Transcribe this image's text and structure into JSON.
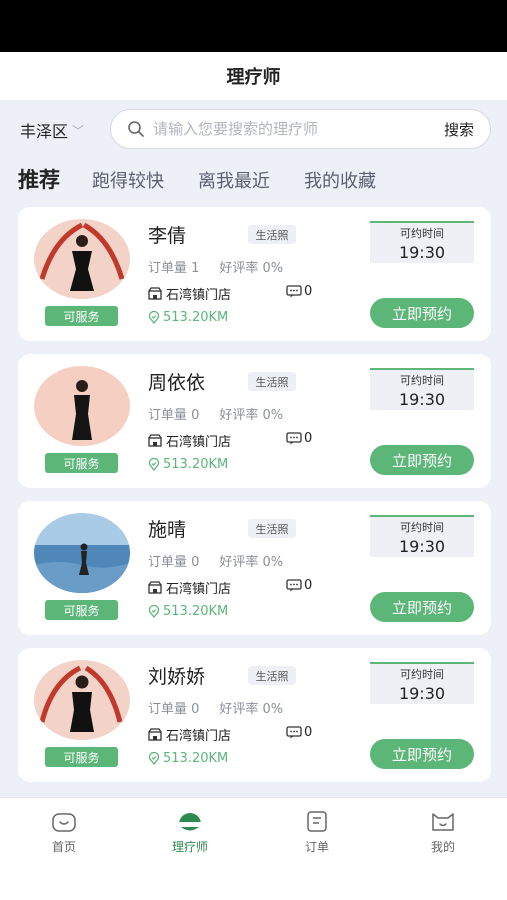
{
  "header": {
    "title": "理疗师"
  },
  "search": {
    "region": "丰泽区",
    "placeholder": "请输入您要搜索的理疗师",
    "button": "搜索"
  },
  "tabs": [
    {
      "label": "推荐",
      "active": true
    },
    {
      "label": "跑得较快",
      "active": false
    },
    {
      "label": "离我最近",
      "active": false
    },
    {
      "label": "我的收藏",
      "active": false
    }
  ],
  "therapists": [
    {
      "name": "李倩",
      "tag": "生活照",
      "orders": "订单量 1",
      "rating": "好评率 0%",
      "store": "石湾镇门店",
      "messages": "0",
      "distance": "513.20KM",
      "time_label": "可约时间",
      "time": "19:30",
      "status": "可服务",
      "book": "立即预约"
    },
    {
      "name": "周依依",
      "tag": "生活照",
      "orders": "订单量 0",
      "rating": "好评率 0%",
      "store": "石湾镇门店",
      "messages": "0",
      "distance": "513.20KM",
      "time_label": "可约时间",
      "time": "19:30",
      "status": "可服务",
      "book": "立即预约"
    },
    {
      "name": "施晴",
      "tag": "生活照",
      "orders": "订单量 0",
      "rating": "好评率 0%",
      "store": "石湾镇门店",
      "messages": "0",
      "distance": "513.20KM",
      "time_label": "可约时间",
      "time": "19:30",
      "status": "可服务",
      "book": "立即预约"
    },
    {
      "name": "刘娇娇",
      "tag": "生活照",
      "orders": "订单量 0",
      "rating": "好评率 0%",
      "store": "石湾镇门店",
      "messages": "0",
      "distance": "513.20KM",
      "time_label": "可约时间",
      "time": "19:30",
      "status": "可服务",
      "book": "立即预约"
    }
  ],
  "bottom_nav": [
    {
      "label": "首页",
      "icon": "home-icon",
      "active": false
    },
    {
      "label": "理疗师",
      "icon": "therapist-icon",
      "active": true
    },
    {
      "label": "订单",
      "icon": "order-icon",
      "active": false
    },
    {
      "label": "我的",
      "icon": "profile-icon",
      "active": false
    }
  ],
  "colors": {
    "accent": "#5cb678",
    "background": "#eef0f8",
    "active_nav": "#2e8b4f"
  }
}
